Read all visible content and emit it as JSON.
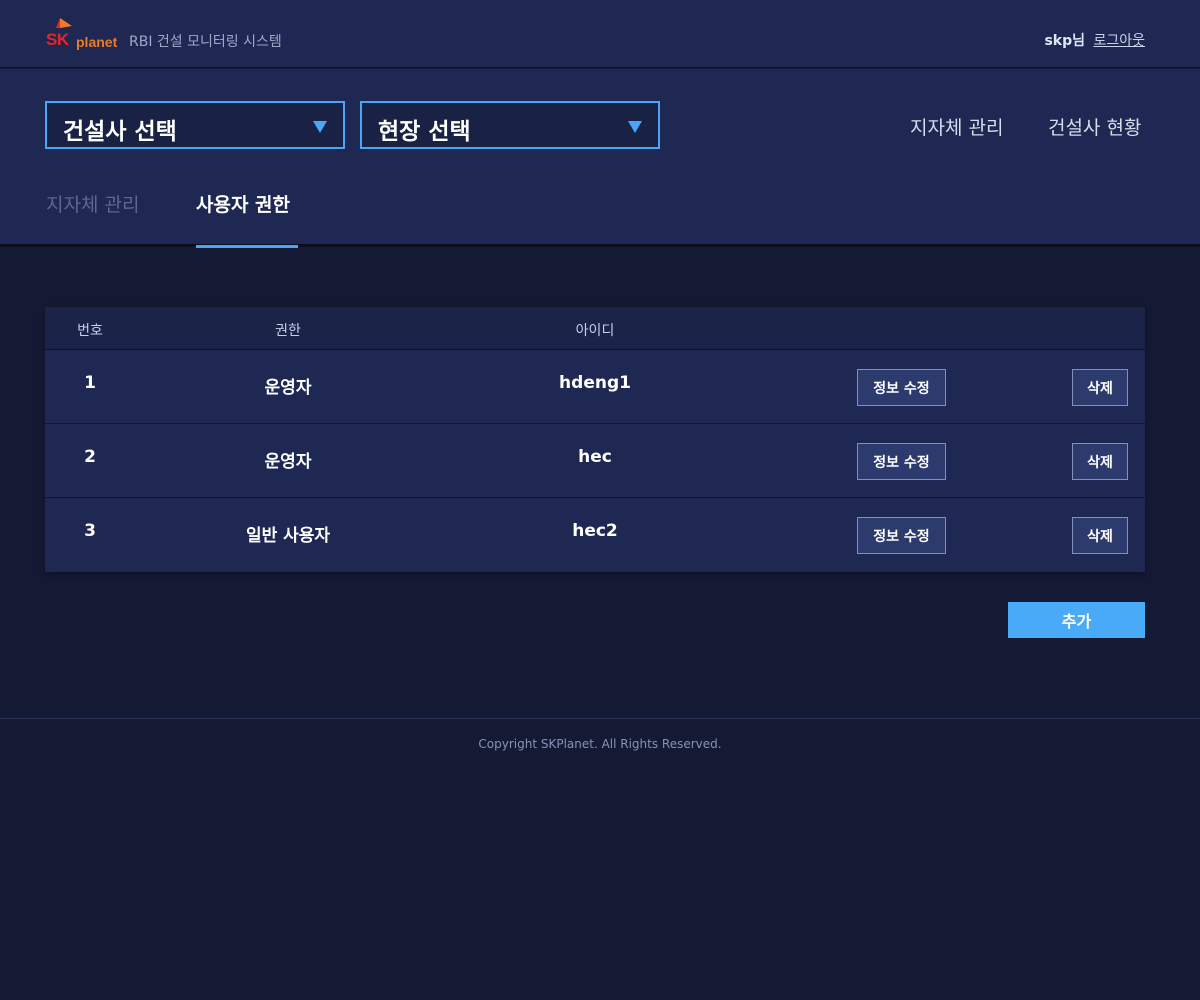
{
  "header": {
    "logo_sk": "SK",
    "logo_planet": "planet",
    "app_title": "RBI 건설 모니터링 시스템",
    "user_name": "skp님",
    "logout_label": "로그아웃",
    "brand_colors": {
      "sk_red": "#e3262e",
      "planet_orange": "#f07a22"
    }
  },
  "filters": {
    "company_select": {
      "value": "건설사 선택",
      "icon": "chevron-down-icon"
    },
    "site_select": {
      "value": "현장 선택",
      "icon": "chevron-down-icon"
    }
  },
  "top_nav": [
    {
      "label": "지자체 관리"
    },
    {
      "label": "건설사 현황"
    }
  ],
  "tabs": [
    {
      "label": "지자체 관리",
      "active": false
    },
    {
      "label": "사용자 권한",
      "active": true
    }
  ],
  "table": {
    "columns": [
      "번호",
      "권한",
      "아이디"
    ],
    "rows": [
      {
        "no": "1",
        "role": "운영자",
        "id": "hdeng1",
        "edit_label": "정보 수정",
        "delete_label": "삭제"
      },
      {
        "no": "2",
        "role": "운영자",
        "id": "hec",
        "edit_label": "정보 수정",
        "delete_label": "삭제"
      },
      {
        "no": "3",
        "role": "일반 사용자",
        "id": "hec2",
        "edit_label": "정보 수정",
        "delete_label": "삭제"
      }
    ]
  },
  "add_button_label": "추가",
  "footer": {
    "copyright": "Copyright SKPlanet. All Rights Reserved."
  },
  "colors": {
    "accent": "#4aa6f5",
    "background": "#151a34",
    "panel": "#1e2852"
  }
}
